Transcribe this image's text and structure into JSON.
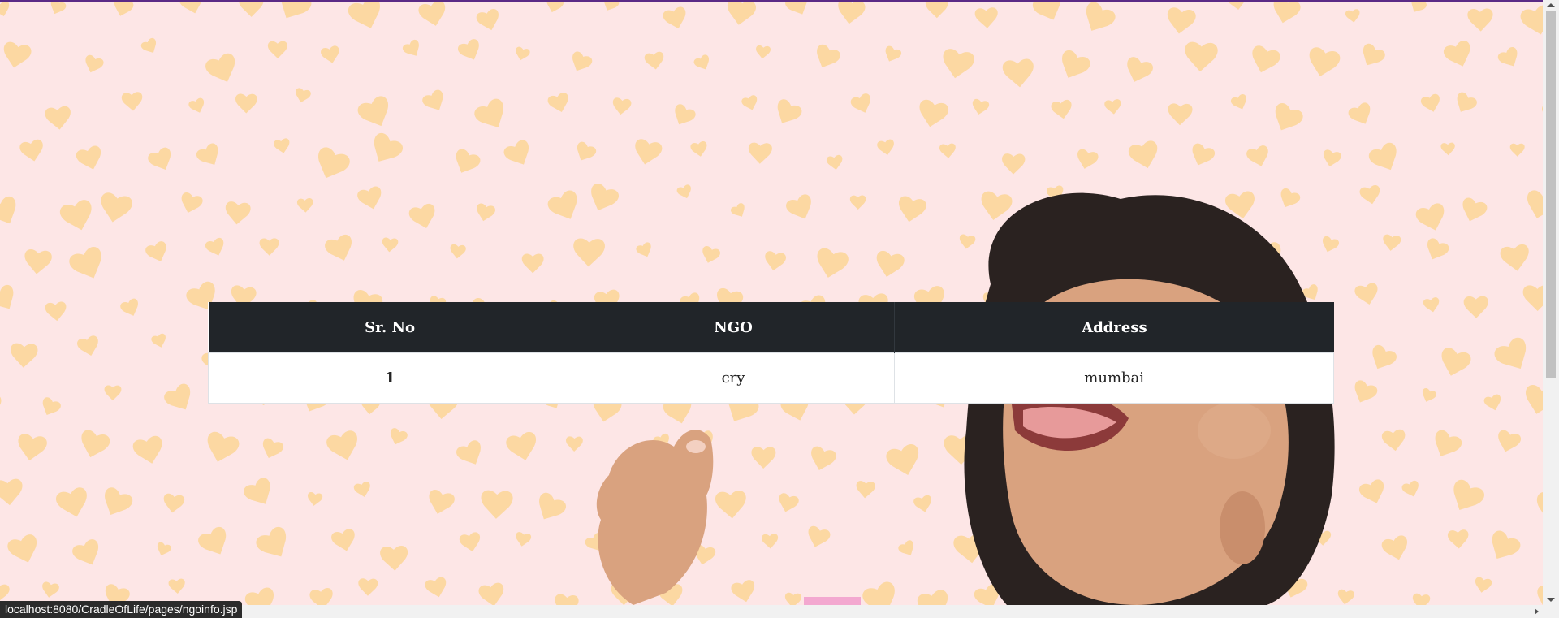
{
  "table": {
    "headers": [
      "Sr. No",
      "NGO",
      "Address"
    ],
    "rows": [
      {
        "sr_no": "1",
        "ngo": "cry",
        "address": "mumbai"
      }
    ]
  },
  "status_bar": {
    "url": "localhost:8080/CradleOfLife/pages/ngoinfo.jsp"
  },
  "colors": {
    "background": "#fde6e6",
    "hearts": "#fcd69a",
    "header_bg": "#212529",
    "accent_bar": "#5b2a86"
  },
  "icons": {
    "background_pattern": "heart-pattern-icon",
    "hero": "baby-photo"
  }
}
